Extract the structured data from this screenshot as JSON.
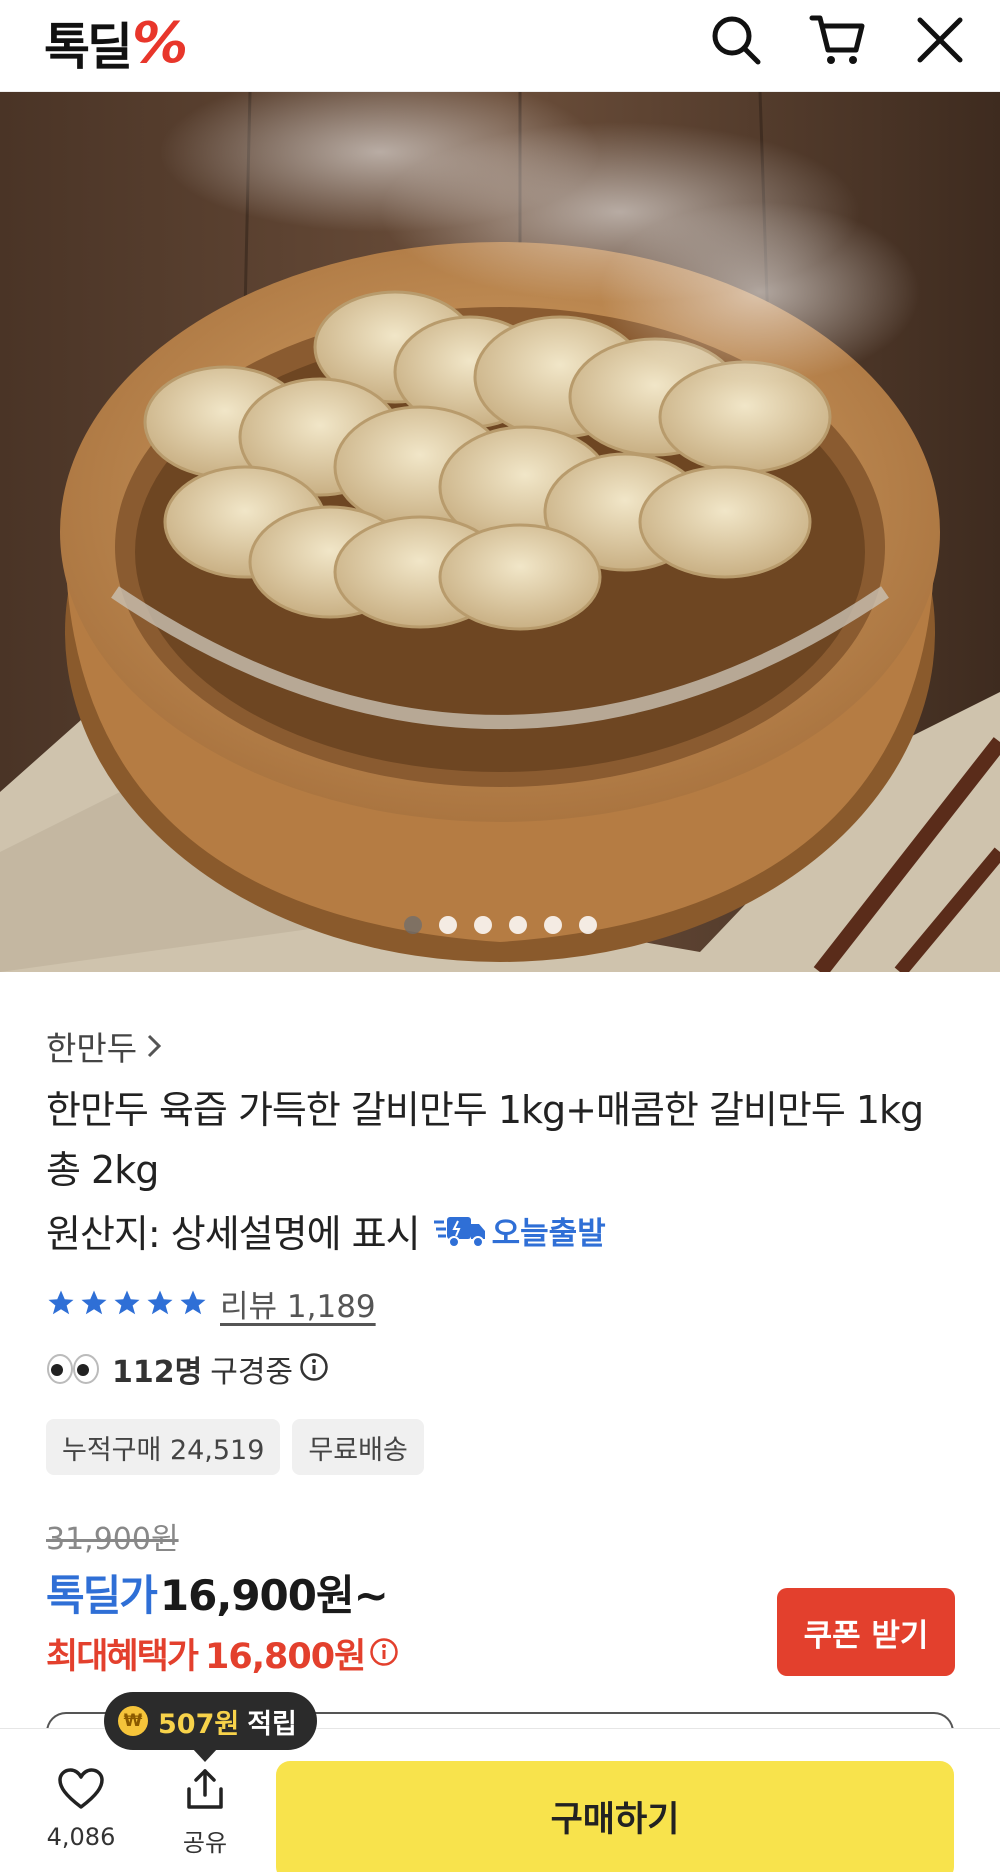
{
  "header": {
    "logo_text": "톡딜",
    "logo_mark": "%",
    "icons": [
      "search-icon",
      "cart-icon",
      "close-icon"
    ]
  },
  "hero": {
    "image_alt": "steamed dumplings in bamboo steamer",
    "carousel_total": 6,
    "carousel_active": 1
  },
  "product": {
    "brand": "한만두",
    "title": "한만두 육즙 가득한 갈비만두 1kg+매콤한 갈비만두 1kg 총 2kg",
    "origin": "원산지: 상세설명에 표시",
    "shipping_label": "오늘출발",
    "rating_stars": 5,
    "review_label": "리뷰 1,189",
    "viewers_count": "112명",
    "viewers_text": "구경중",
    "badges": [
      "누적구매 24,519",
      "무료배송"
    ]
  },
  "price": {
    "original": "31,900원",
    "deal_label": "톡딜가",
    "deal_price": "16,900원~",
    "max_label": "최대혜택가",
    "max_price": "16,800원",
    "coupon_button": "쿠폰 받기"
  },
  "tooltip": {
    "coin_symbol": "₩",
    "points": "507원",
    "text": "적립"
  },
  "bottom_bar": {
    "like_count": "4,086",
    "share_label": "공유",
    "buy_button": "구매하기"
  },
  "colors": {
    "brand_red": "#e3402d",
    "deal_blue": "#2f6fd6",
    "buy_yellow": "#f8e34c"
  }
}
